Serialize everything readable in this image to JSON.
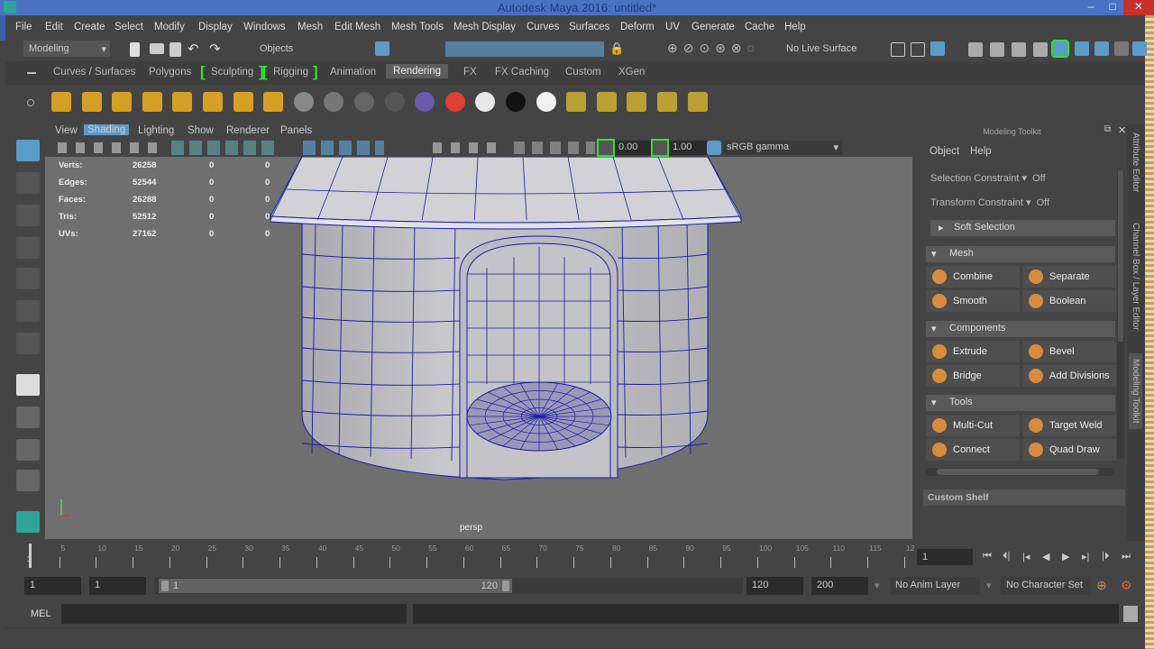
{
  "window": {
    "title": "Autodesk Maya 2016: untitled*",
    "minimize": "–",
    "maximize": "□",
    "close": "✕"
  },
  "menubar": [
    "File",
    "Edit",
    "Create",
    "Select",
    "Modify",
    "Display",
    "Windows",
    "Mesh",
    "Edit Mesh",
    "Mesh Tools",
    "Mesh Display",
    "Curves",
    "Surfaces",
    "Deform",
    "UV",
    "Generate",
    "Cache",
    "Help"
  ],
  "statusline": {
    "menuset": "Modeling",
    "selection_mode": "Objects",
    "live_surface": "No Live Surface"
  },
  "shelf": {
    "tabs": [
      "Curves / Surfaces",
      "Polygons",
      "Sculpting",
      "Rigging",
      "Animation",
      "Rendering",
      "FX",
      "FX Caching",
      "Custom",
      "XGen"
    ],
    "active_tab": "Rendering"
  },
  "viewport": {
    "menu": [
      "View",
      "Shading",
      "Lighting",
      "Show",
      "Renderer",
      "Panels"
    ],
    "active_menu": "Shading",
    "exposure": "0.00",
    "gamma": "1.00",
    "color_space": "sRGB gamma",
    "camera_label": "persp",
    "hud": [
      {
        "label": "Verts:",
        "v": "26258",
        "a": "0",
        "b": "0"
      },
      {
        "label": "Edges:",
        "v": "52544",
        "a": "0",
        "b": "0"
      },
      {
        "label": "Faces:",
        "v": "26288",
        "a": "0",
        "b": "0"
      },
      {
        "label": "Tris:",
        "v": "52512",
        "a": "0",
        "b": "0"
      },
      {
        "label": "UVs:",
        "v": "27162",
        "a": "0",
        "b": "0"
      }
    ]
  },
  "toolkit": {
    "title": "Modeling Toolkit",
    "menu": [
      "Object",
      "Help"
    ],
    "selection_constraint": "Selection Constraint",
    "selection_constraint_value": "Off",
    "transform_constraint": "Transform Constraint",
    "transform_constraint_value": "Off",
    "soft_selection": "Soft Selection",
    "sections": [
      {
        "name": "Mesh",
        "buttons": [
          "Combine",
          "Separate",
          "Smooth",
          "Boolean"
        ]
      },
      {
        "name": "Components",
        "buttons": [
          "Extrude",
          "Bevel",
          "Bridge",
          "Add Divisions"
        ]
      },
      {
        "name": "Tools",
        "buttons": [
          "Multi-Cut",
          "Target Weld",
          "Connect",
          "Quad Draw"
        ]
      }
    ],
    "custom_shelf": "Custom Shelf"
  },
  "side_tabs": [
    "Attribute Editor",
    "Channel Box / Layer Editor",
    "Modeling Toolkit"
  ],
  "timeline": {
    "ticks": [
      "1",
      "5",
      "10",
      "15",
      "20",
      "25",
      "30",
      "35",
      "40",
      "45",
      "50",
      "55",
      "60",
      "65",
      "70",
      "75",
      "80",
      "85",
      "90",
      "95",
      "100",
      "105",
      "110",
      "115",
      "12"
    ],
    "current_frame": "1",
    "range_start": "1",
    "playback_start": "1",
    "range_slider_start": "1",
    "range_slider_end": "120",
    "playback_end": "120",
    "range_end": "200",
    "anim_layer": "No Anim Layer",
    "character_set": "No Character Set"
  },
  "playback_buttons": [
    "⏮",
    "⏴|",
    "|◂",
    "◀",
    "▶",
    "▸|",
    "|⏵",
    "⏭"
  ],
  "command_line": {
    "language": "MEL"
  },
  "colors": {
    "titlebar": "#4a72c2",
    "accent": "#5b9bc8",
    "highlight_green": "#2fe32f",
    "wire": "#1a1aa8"
  }
}
